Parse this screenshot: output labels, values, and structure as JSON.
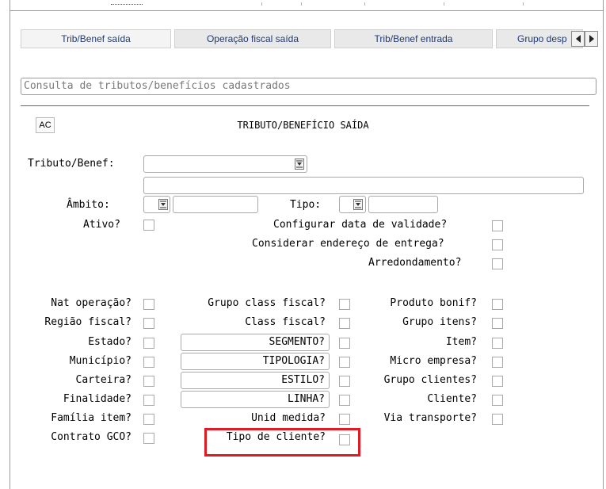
{
  "tabs": [
    {
      "label": "Trib/Benef saída",
      "active": true
    },
    {
      "label": "Operação fiscal saída",
      "active": false
    },
    {
      "label": "Trib/Benef entrada",
      "active": false
    },
    {
      "label": "Grupo desp",
      "active": false
    }
  ],
  "tab_scroll": {
    "left_icon": "arrow-left-icon",
    "right_icon": "arrow-right-icon"
  },
  "search": {
    "placeholder": "Consulta de tributos/benefícios cadastrados"
  },
  "form": {
    "ac_button": "AC",
    "title": "TRIBUTO/BENEFÍCIO SAÍDA",
    "tributo_label": "Tributo/Benef:",
    "ambito_label": "Âmbito:",
    "tipo_label": "Tipo:",
    "ativo_label": "Ativo?",
    "configurar_label": "Configurar data de validade?",
    "considerar_label": "Considerar endereço de entrega?",
    "arredondamento_label": "Arredondamento?"
  },
  "col1": [
    "Nat operação?",
    "Região fiscal?",
    "Estado?",
    "Município?",
    "Carteira?",
    "Finalidade?",
    "Família item?",
    "Contrato GCO?"
  ],
  "col2_labels": [
    "Grupo class fiscal?",
    "Class fiscal?",
    "Unid medida?",
    "Tipo de cliente?"
  ],
  "col2_fields": [
    "SEGMENTO?",
    "TIPOLOGIA?",
    "ESTILO?",
    "LINHA?"
  ],
  "col3": [
    "Produto bonif?",
    "Grupo itens?",
    "Item?",
    "Micro empresa?",
    "Grupo clientes?",
    "Cliente?",
    "Via transporte?"
  ],
  "colors": {
    "tab_text": "#1f3a73",
    "highlight": "#e01b24",
    "separator": "#d43a3a"
  }
}
